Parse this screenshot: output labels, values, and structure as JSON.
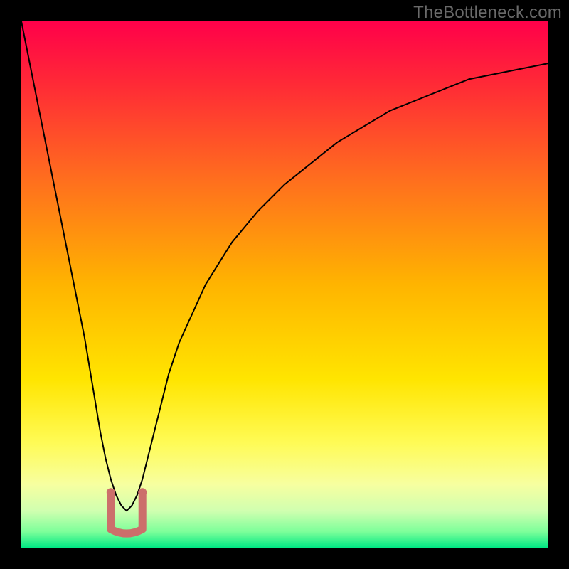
{
  "watermark": "TheBottleneck.com",
  "chart_data": {
    "type": "line",
    "title": "",
    "xlabel": "",
    "ylabel": "",
    "xlim": [
      0,
      100
    ],
    "ylim": [
      0,
      100
    ],
    "grid": false,
    "legend": false,
    "annotations": [],
    "background": {
      "type": "vertical-gradient",
      "stops": [
        {
          "pos": 0.0,
          "color": "#ff004a"
        },
        {
          "pos": 0.12,
          "color": "#ff2a36"
        },
        {
          "pos": 0.3,
          "color": "#ff6e1e"
        },
        {
          "pos": 0.5,
          "color": "#ffb400"
        },
        {
          "pos": 0.68,
          "color": "#ffe500"
        },
        {
          "pos": 0.8,
          "color": "#fffb55"
        },
        {
          "pos": 0.88,
          "color": "#f7ffa0"
        },
        {
          "pos": 0.93,
          "color": "#d0ffb0"
        },
        {
          "pos": 0.97,
          "color": "#7cff9a"
        },
        {
          "pos": 1.0,
          "color": "#00e884"
        }
      ]
    },
    "series": [
      {
        "name": "curve",
        "color": "#000000",
        "stroke_width": 2,
        "notch_x": 20,
        "notch_y_pct": 93,
        "notch_half_width_pct": 3,
        "marker": {
          "color": "#cc6f6b",
          "radius_px": 6
        },
        "x": [
          0,
          1,
          2,
          3,
          4,
          5,
          6,
          7,
          8,
          9,
          10,
          11,
          12,
          13,
          14,
          15,
          16,
          17,
          18,
          19,
          20,
          21,
          22,
          23,
          24,
          25,
          26,
          27,
          28,
          29,
          30,
          35,
          40,
          45,
          50,
          55,
          60,
          65,
          70,
          75,
          80,
          85,
          90,
          95,
          100
        ],
        "y_pct_from_top": [
          0,
          5,
          10,
          15,
          20,
          25,
          30,
          35,
          40,
          45,
          50,
          55,
          60,
          66,
          72,
          78,
          83,
          87,
          90,
          92,
          93,
          92,
          90,
          87,
          83,
          79,
          75,
          71,
          67,
          64,
          61,
          50,
          42,
          36,
          31,
          27,
          23,
          20,
          17,
          15,
          13,
          11,
          10,
          9,
          8
        ]
      }
    ]
  }
}
